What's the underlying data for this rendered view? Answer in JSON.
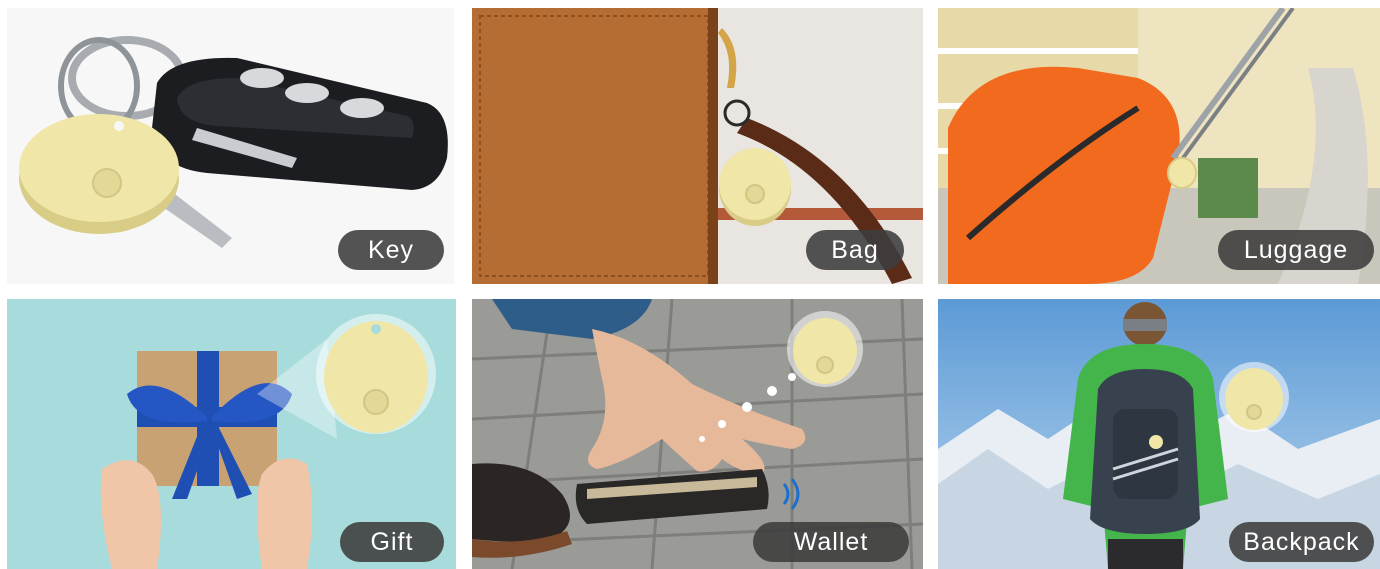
{
  "tiles": [
    {
      "id": "key",
      "label": "Key"
    },
    {
      "id": "bag",
      "label": "Bag"
    },
    {
      "id": "luggage",
      "label": "Luggage"
    },
    {
      "id": "gift",
      "label": "Gift"
    },
    {
      "id": "wallet",
      "label": "Wallet"
    },
    {
      "id": "backpack",
      "label": "Backpack"
    }
  ],
  "colors": {
    "tracker": "#efe6a8",
    "tracker_shadow": "#d8cc86",
    "label_bg": "#3c3c3c",
    "label_text": "#ffffff"
  }
}
